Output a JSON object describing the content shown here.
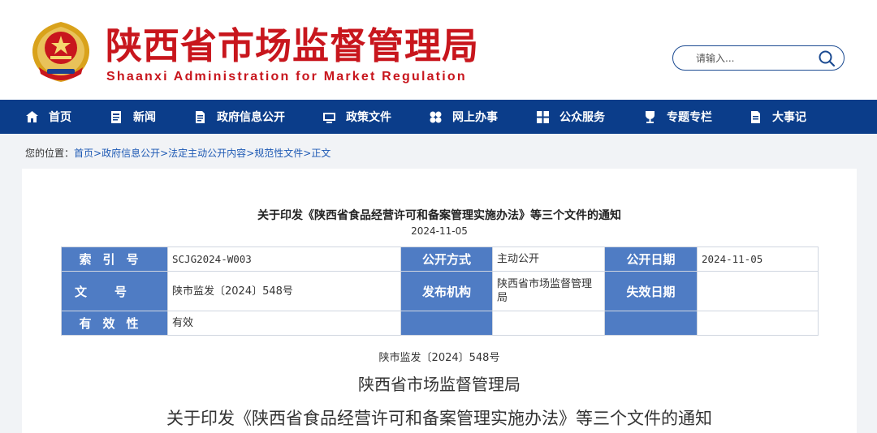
{
  "header": {
    "title": "陕西省市场监督管理局",
    "subtitle": "Shaanxi Administration for Market Regulation",
    "search_placeholder": "请输入..."
  },
  "colors": {
    "brand_red": "#c8161d",
    "nav_blue": "#0b3d8a",
    "label_blue": "#4f7cc4",
    "link_blue": "#1d59b4"
  },
  "nav": {
    "items": [
      {
        "label": "首页",
        "icon": "home-icon"
      },
      {
        "label": "新闻",
        "icon": "news-icon"
      },
      {
        "label": "政府信息公开",
        "icon": "document-icon"
      },
      {
        "label": "政策文件",
        "icon": "policy-icon"
      },
      {
        "label": "网上办事",
        "icon": "service-icon"
      },
      {
        "label": "公众服务",
        "icon": "grid-icon"
      },
      {
        "label": "专题专栏",
        "icon": "trophy-icon"
      },
      {
        "label": "大事记",
        "icon": "record-icon"
      }
    ]
  },
  "breadcrumb": {
    "prefix": "您的位置：",
    "items": [
      "首页",
      "政府信息公开",
      "法定主动公开内容",
      "规范性文件",
      "正文"
    ],
    "separator": ">"
  },
  "article": {
    "title": "关于印发《陕西省食品经营许可和备案管理实施办法》等三个文件的通知",
    "date": "2024-11-05",
    "meta": {
      "index_label": "索引号",
      "index_value": "SCJG2024-W003",
      "disclosure_label": "公开方式",
      "disclosure_value": "主动公开",
      "open_date_label": "公开日期",
      "open_date_value": "2024-11-05",
      "doc_no_label": "文号",
      "doc_no_value": "陕市监发〔2024〕548号",
      "publisher_label": "发布机构",
      "publisher_value": "陕西省市场监督管理局",
      "expiry_label": "失效日期",
      "expiry_value": "",
      "validity_label": "有效性",
      "validity_value": "有效"
    },
    "doc_number_line": "陕市监发〔2024〕548号",
    "issuer_line": "陕西省市场监督管理局",
    "notice_title": "关于印发《陕西省食品经营许可和备案管理实施办法》等三个文件的通知"
  }
}
